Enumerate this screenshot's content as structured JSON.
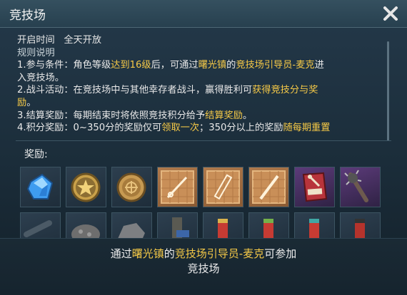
{
  "window": {
    "title": "竞技场"
  },
  "info": {
    "open_time_label": "开启时间",
    "open_time_value": "全天开放",
    "rules_heading": "规则说明",
    "rule1": {
      "a": "1.参与条件：角色等级",
      "b": "达到16级",
      "c": "后，可通过",
      "d": "曙光镇",
      "e": "的",
      "f": "竞技场引导员-麦克",
      "g": "进",
      "h": "入竞技场。"
    },
    "rule2": {
      "a": "2.战斗活动：在竞技场中与其他幸存者战斗，赢得胜利可",
      "b": "获得竞技分与奖",
      "c": "励",
      "d": "。"
    },
    "rule3": {
      "a": "3.结算奖励：每期结束时将依照竞技积分给予",
      "b": "结算奖励",
      "c": "。"
    },
    "rule4": {
      "a": "4.积分奖励：0~350分的奖励仅可",
      "b": "领取一次",
      "c": "；350分以上的奖励",
      "d": "随每期重置"
    }
  },
  "rewards": {
    "label": "奖励:",
    "items": [
      {
        "name": "blue-crystal-icon"
      },
      {
        "name": "gold-star-medal-icon"
      },
      {
        "name": "bronze-coin-icon"
      },
      {
        "name": "blueprint-tools-icon"
      },
      {
        "name": "blueprint-plank-icon"
      },
      {
        "name": "blueprint-stick-icon"
      },
      {
        "name": "handbook-icon"
      },
      {
        "name": "spiked-bat-icon"
      },
      {
        "name": "pipe-icon"
      },
      {
        "name": "ore-icon"
      },
      {
        "name": "rock-icon"
      },
      {
        "name": "wrench-part-icon"
      },
      {
        "name": "red-shell-icon"
      },
      {
        "name": "green-shell-icon"
      },
      {
        "name": "teal-shell-icon"
      },
      {
        "name": "dark-shell-icon"
      }
    ]
  },
  "footer": {
    "a": "通过",
    "b": "曙光镇",
    "c": "的",
    "d": "竞技场引导员-麦克",
    "e": "可参加",
    "f": "竞技场"
  },
  "colors": {
    "highlight": "#f5c947",
    "panel": "#1c2f3b"
  }
}
